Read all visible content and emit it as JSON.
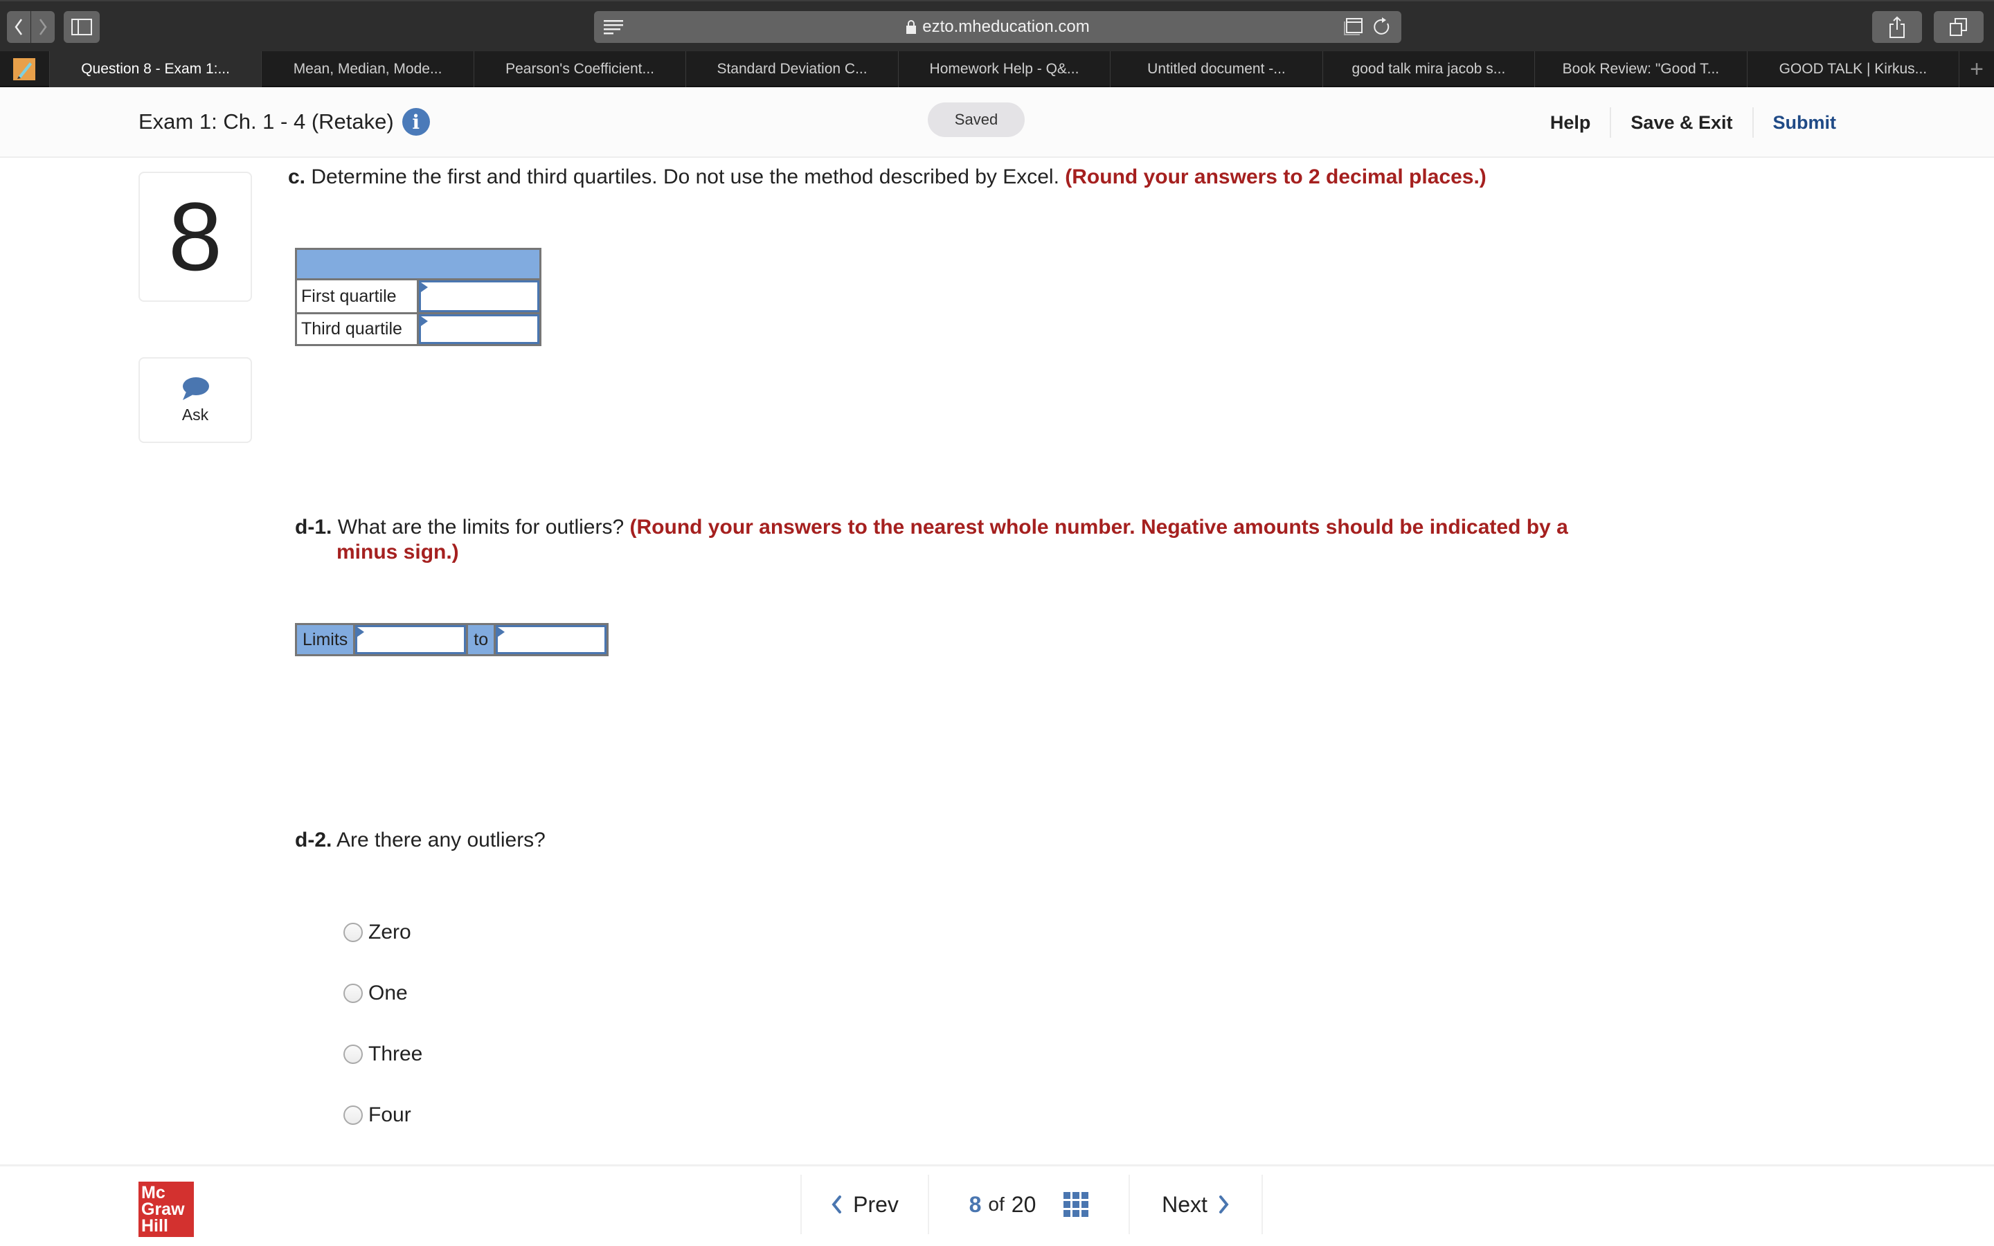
{
  "browser": {
    "url": "ezto.mheducation.com",
    "tabs": [
      {
        "label": "Question 8 - Exam 1:...",
        "active": true
      },
      {
        "label": "Mean, Median, Mode...",
        "active": false
      },
      {
        "label": "Pearson's Coefficient...",
        "active": false
      },
      {
        "label": "Standard Deviation C...",
        "active": false
      },
      {
        "label": "Homework Help - Q&...",
        "active": false
      },
      {
        "label": "Untitled document -...",
        "active": false
      },
      {
        "label": "good talk mira jacob s...",
        "active": false
      },
      {
        "label": "Book Review: \"Good T...",
        "active": false
      },
      {
        "label": "GOOD TALK | Kirkus...",
        "active": false
      }
    ],
    "new_tab_label": "+"
  },
  "header": {
    "exam_title": "Exam 1: Ch. 1 - 4 (Retake)",
    "info_icon": "i",
    "status": "Saved",
    "links": {
      "help": "Help",
      "save_exit": "Save & Exit",
      "submit": "Submit"
    }
  },
  "sidebar": {
    "question_number": "8",
    "ask_label": "Ask"
  },
  "question": {
    "part_c": {
      "label": "c.",
      "text": "Determine the first and third quartiles. Do not use the method described by Excel.",
      "hint": "(Round your answers to 2 decimal places.)",
      "table": {
        "header": "",
        "rows": [
          {
            "label": "First quartile",
            "value": ""
          },
          {
            "label": "Third quartile",
            "value": ""
          }
        ]
      }
    },
    "part_d1": {
      "label": "d-1.",
      "text": "What are the limits for outliers?",
      "hint_line1": "(Round your answers to the nearest whole number. Negative amounts should be indicated by a",
      "hint_line2": "minus sign.)",
      "limits_label": "Limits",
      "to_label": "to",
      "lower_value": "",
      "upper_value": ""
    },
    "part_d2": {
      "label": "d-2.",
      "text": "Are there any outliers?",
      "options": [
        "Zero",
        "One",
        "Three",
        "Four"
      ],
      "selected": null
    }
  },
  "footer": {
    "logo_lines": [
      "Mc",
      "Graw",
      "Hill"
    ],
    "prev_label": "Prev",
    "current_page": "8",
    "of_label": "of",
    "total_pages": "20",
    "next_label": "Next"
  },
  "colors": {
    "accent_blue": "#4a76b0",
    "hint_red": "#a5201f",
    "submit_blue": "#1f4a86",
    "table_header": "#81abdf",
    "logo_red": "#d3312f"
  }
}
